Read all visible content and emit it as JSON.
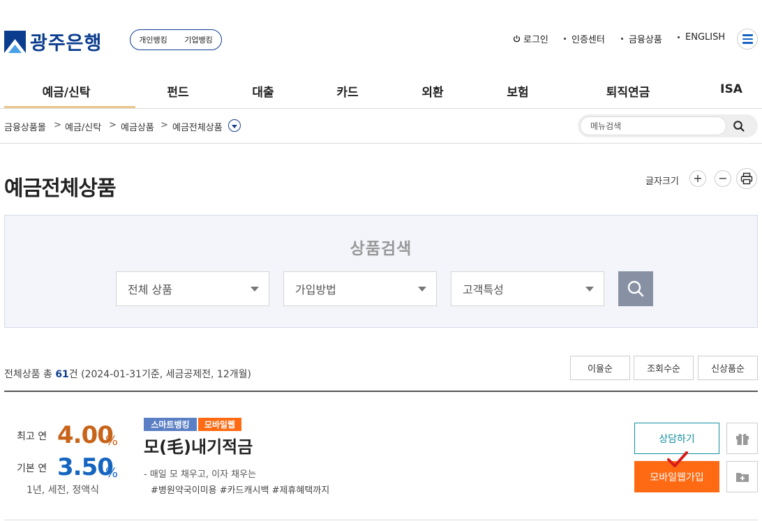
{
  "header": {
    "logo_text": "광주은행",
    "bank_toggle": [
      "개인뱅킹",
      "기업뱅킹"
    ],
    "util_links": [
      "로그인",
      "인증센터",
      "금융상품",
      "ENGLISH"
    ]
  },
  "gnb": [
    "예금/신탁",
    "펀드",
    "대출",
    "카드",
    "외환",
    "보험",
    "퇴직연금",
    "ISA"
  ],
  "breadcrumb": [
    "금융상품몰",
    "예금/신탁",
    "예금상품",
    "예금전체상품"
  ],
  "menu_search": {
    "placeholder": "메뉴검색"
  },
  "page": {
    "title": "예금전체상품",
    "font_size_label": "글자크기",
    "plus": "+",
    "minus": "−"
  },
  "search_panel": {
    "title": "상품검색",
    "selects": [
      "전체 상품",
      "가입방법",
      "고객특성"
    ]
  },
  "list": {
    "total_prefix": "전체상품 총 ",
    "total_count": "61",
    "total_suffix": "건 (2024-01-31기준, 세금공제전, 12개월)",
    "sort_buttons": [
      "이율순",
      "조회수순",
      "신상품순"
    ]
  },
  "product": {
    "max_label": "최고 연",
    "max_rate": "4.00",
    "base_label": "기본 연",
    "base_rate": "3.50",
    "pct": "%",
    "conditions": "1년, 세전, 정액식",
    "badges": [
      {
        "label": "스마트뱅킹",
        "color": "#5a7fc4"
      },
      {
        "label": "모바일웹",
        "color": "#ff6a13"
      }
    ],
    "name": "모(毛)내기적금",
    "desc": "- 매일 모 채우고, 이자 채우는",
    "tags": "#병원약국이미용 #카드캐시백 #제휴혜택까지",
    "consult_label": "상담하기",
    "join_label": "모바일웹가입"
  },
  "colors": {
    "brand": "#0b3d8f",
    "max_rate": "#c8641a",
    "base_rate": "#1565c0",
    "join": "#ff6a13",
    "consult": "#0f8da0"
  }
}
